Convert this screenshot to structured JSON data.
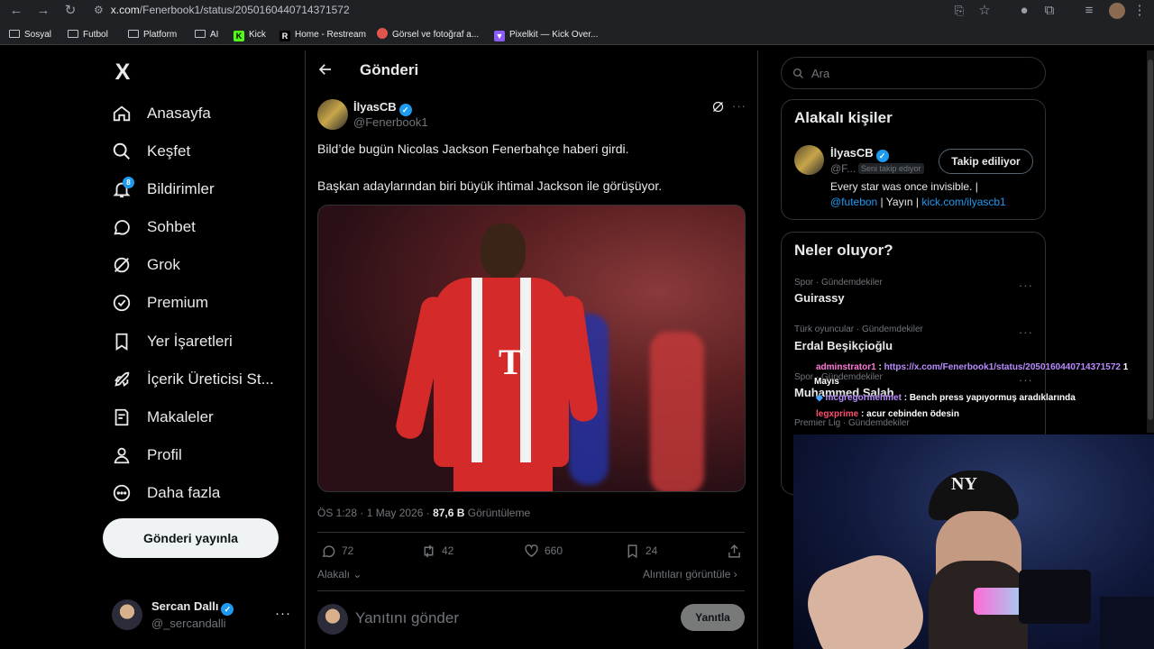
{
  "browser": {
    "url_host": "x.com",
    "url_path": "/Fenerbook1/status/2050160440714371572",
    "bookmarks": [
      {
        "label": "Sosyal",
        "type": "folder"
      },
      {
        "label": "Futbol",
        "type": "folder"
      },
      {
        "label": "Platform",
        "type": "folder"
      },
      {
        "label": "AI",
        "type": "folder"
      },
      {
        "label": "Kick",
        "type": "site",
        "color": "#53fc18",
        "glyph": "K"
      },
      {
        "label": "Home - Restream",
        "type": "site",
        "color": "#ffffff",
        "glyph": "R"
      },
      {
        "label": "Görsel ve fotoğraf a...",
        "type": "site",
        "color": "#e0564f",
        "glyph": "●"
      },
      {
        "label": "Pixelkit — Kick Over...",
        "type": "site",
        "color": "#8b5cf6",
        "glyph": "▼"
      }
    ]
  },
  "nav": {
    "logo": "X",
    "items": [
      {
        "label": "Anasayfa",
        "icon": "home-icon"
      },
      {
        "label": "Keşfet",
        "icon": "search-icon"
      },
      {
        "label": "Bildirimler",
        "icon": "bell-icon"
      },
      {
        "label": "Sohbet",
        "icon": "chat-icon"
      },
      {
        "label": "Grok",
        "icon": "grok-icon"
      },
      {
        "label": "Premium",
        "icon": "premium-icon"
      },
      {
        "label": "Yer İşaretleri",
        "icon": "bookmark-icon"
      },
      {
        "label": "İçerik Üreticisi St...",
        "icon": "rocket-icon"
      },
      {
        "label": "Makaleler",
        "icon": "article-icon"
      },
      {
        "label": "Profil",
        "icon": "person-icon"
      },
      {
        "label": "Daha fazla",
        "icon": "more-circle-icon"
      }
    ],
    "notification_count": "8",
    "post_button": "Gönderi yayınla",
    "account_name": "Sercan Dallı",
    "account_handle": "@_sercandalli"
  },
  "post": {
    "header_title": "Gönderi",
    "author_name": "İlyasCB",
    "author_handle": "@Fenerbook1",
    "text_line1": "Bild’de bugün Nicolas Jackson Fenerbahçe haberi girdi.",
    "text_line2": "Başkan adaylarından biri büyük ihtimal Jackson ile görüşüyor.",
    "image_shirt_letter": "T",
    "timestamp": "ÖS 1:28 · 1 May 2026 · ",
    "views_count": "87,6 B",
    "views_label": " Görüntüleme",
    "stats": {
      "replies": "72",
      "reposts": "42",
      "likes": "660",
      "bookmarks": "24"
    },
    "related_label": "Alakalı",
    "quotes_label": "Alıntıları görüntüle",
    "reply_placeholder": "Yanıtını gönder",
    "reply_button": "Yanıtla"
  },
  "sidebar": {
    "search_placeholder": "Ara",
    "related_title": "Alakalı kişiler",
    "person_name": "İlyasCB",
    "person_handle": "@F...",
    "follows_you": "Seni takip ediyor",
    "following_button": "Takip ediliyor",
    "bio_line1": "Every star was once invisible. |",
    "bio_mention": "@futebon",
    "bio_mid": " | Yayın | ",
    "bio_link": "kick.com/ilyascb1",
    "trends_title": "Neler oluyor?",
    "trends": [
      {
        "category": "Spor · Gündemdekiler",
        "name": "Guirassy"
      },
      {
        "category": "Türk oyuncular · Gündemdekiler",
        "name": "Erdal Beşikçioğlu"
      },
      {
        "category": "Spor · Gündemdekiler",
        "name": "Muhammed Salah"
      },
      {
        "category": "Premier Lig · Gündemdekiler",
        "name": ""
      }
    ]
  },
  "chat": [
    {
      "user": "adminstrator1",
      "color": "#ff7ad9",
      "message": " : ",
      "link": "https://x.com/Fenerbook1/status/2050160440714371572",
      "tail": " 1"
    },
    {
      "user": "",
      "color": "#ffffff",
      "message": "Mayıs",
      "link": "",
      "tail": ""
    },
    {
      "user": "mcgregormehmet",
      "color": "#b98cff",
      "message": " : Bench press yapıyormuş aradıklarında",
      "link": "",
      "tail": ""
    },
    {
      "user": "legxprime",
      "color": "#ff4d6d",
      "message": " : acur cebinden ödesin",
      "link": "",
      "tail": ""
    }
  ],
  "webcam": {
    "cap_logo": "NY"
  }
}
